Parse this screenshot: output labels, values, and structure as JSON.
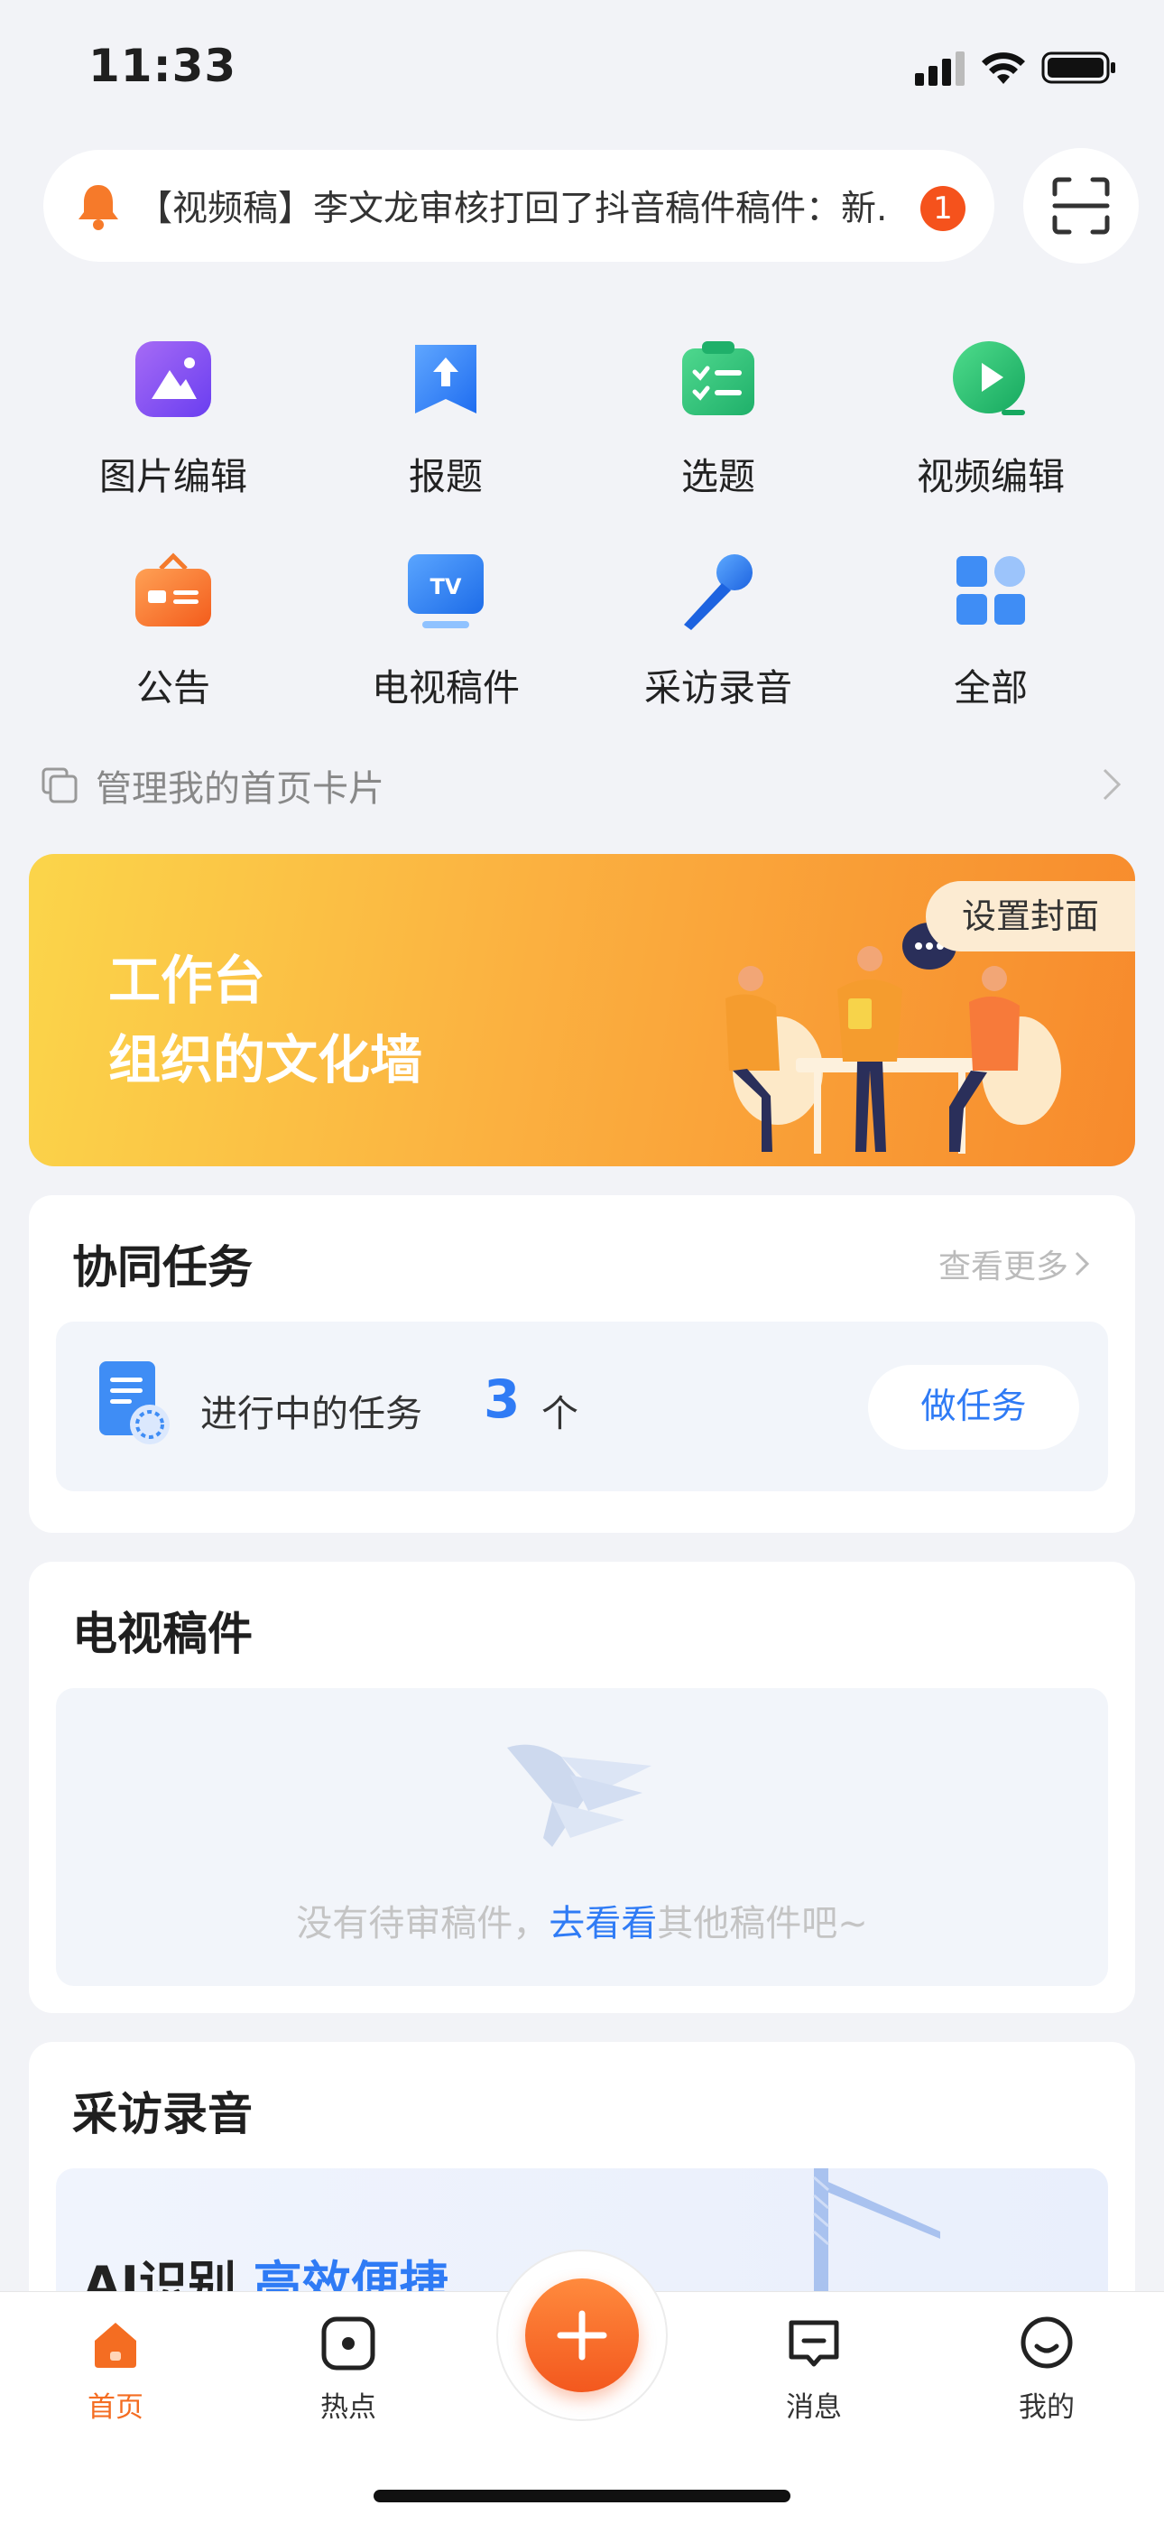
{
  "status_bar": {
    "time": "11:33"
  },
  "notice": {
    "text": "【视频稿】李文龙审核打回了抖音稿件稿件：新.",
    "badge": "1"
  },
  "quick_actions": [
    {
      "label": "图片编辑",
      "icon": "image-edit-icon"
    },
    {
      "label": "报题",
      "icon": "report-topic-icon"
    },
    {
      "label": "选题",
      "icon": "topic-list-icon"
    },
    {
      "label": "视频编辑",
      "icon": "video-edit-icon"
    },
    {
      "label": "公告",
      "icon": "announcement-icon"
    },
    {
      "label": "电视稿件",
      "icon": "tv-icon"
    },
    {
      "label": "采访录音",
      "icon": "microphone-icon"
    },
    {
      "label": "全部",
      "icon": "grid-all-icon"
    }
  ],
  "manage": {
    "label": "管理我的首页卡片"
  },
  "banner": {
    "line1": "工作台",
    "line2": "组织的文化墙",
    "button": "设置封面"
  },
  "task_card": {
    "title": "协同任务",
    "more": "查看更多",
    "task_text": "进行中的任务",
    "task_count": "3",
    "task_unit": "个",
    "button": "做任务"
  },
  "tv_card": {
    "title": "电视稿件",
    "empty_prefix": "没有待审稿件，",
    "empty_link": "去看看",
    "empty_suffix": "其他稿件吧~"
  },
  "audio_card": {
    "title": "采访录音",
    "ai_title": "AI识别",
    "ai_sub": "高效便捷"
  },
  "tab_bar": {
    "items": [
      {
        "label": "首页",
        "active": true
      },
      {
        "label": "热点",
        "active": false
      },
      {
        "label": "消息",
        "active": false
      },
      {
        "label": "我的",
        "active": false
      }
    ]
  },
  "colors": {
    "accent": "#f46d22",
    "link": "#2f7bf5"
  }
}
